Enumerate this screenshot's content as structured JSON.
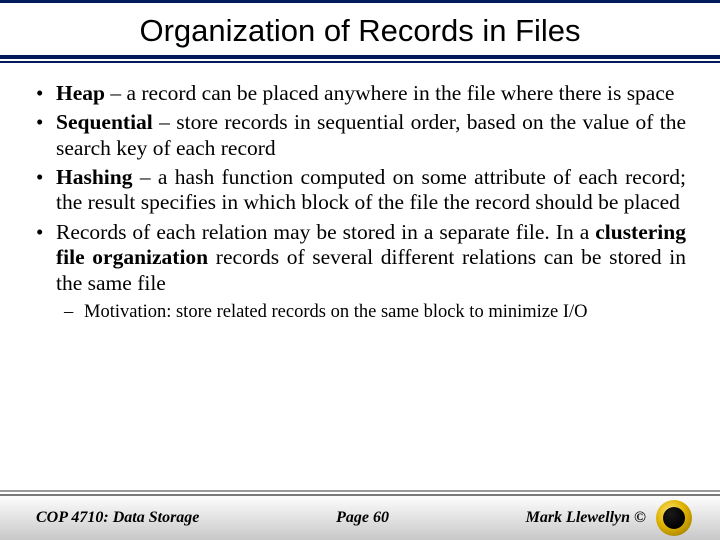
{
  "title": "Organization of Records in Files",
  "bullets": {
    "b1_term": "Heap",
    "b1_rest": " – a record can be placed anywhere in the file where there is space",
    "b2_term": "Sequential",
    "b2_rest": " – store records in sequential order, based on the value of the search key of each record",
    "b3_term": "Hashing",
    "b3_rest": " – a hash function computed on some attribute of each record; the result specifies in which block of the file the record should be placed",
    "b4_pre": "Records of each relation may be stored in a separate file. In a ",
    "b4_term": "clustering file organization",
    "b4_post": " records of several different relations can be stored in the same file",
    "sub1": "Motivation: store related records on the same block to minimize I/O"
  },
  "footer": {
    "left": "COP 4710: Data Storage",
    "center": "Page 60",
    "right": "Mark Llewellyn ©"
  }
}
